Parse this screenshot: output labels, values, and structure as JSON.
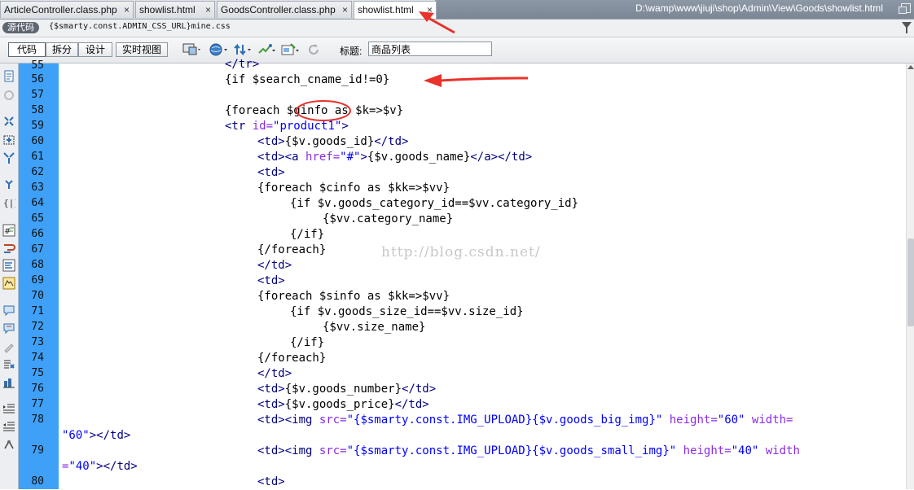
{
  "tabs": [
    {
      "label": "ArticleController.class.php",
      "active": false
    },
    {
      "label": "showlist.html",
      "active": false
    },
    {
      "label": "GoodsController.class.php",
      "active": false
    },
    {
      "label": "showlist.html",
      "active": true
    }
  ],
  "tab_close_glyph": "×",
  "file_path": "D:\\wamp\\www\\jiuji\\shop\\Admin\\View\\Goods\\showlist.html",
  "related_bar": {
    "source_label": "源代码",
    "related_file": "{$smarty.const.ADMIN_CSS_URL}mine.css"
  },
  "toolbar": {
    "views": [
      "代码",
      "拆分",
      "设计",
      "实时视图"
    ],
    "active_view": "代码",
    "title_label": "标题:",
    "title_value": "商品列表"
  },
  "icons": {
    "toolbar": [
      "multiscreen-icon",
      "preview-globe-icon",
      "file-transfer-icon",
      "debug-icon",
      "visual-aids-icon",
      "refresh-icon"
    ],
    "sidebar": [
      "open-documents-icon",
      "collapse-tag-icon",
      "collapse-selection-icon",
      "expand-all-icon",
      "select-parent-tag-icon",
      "balance-braces-icon",
      "line-numbers-icon",
      "highlight-invalid-icon",
      "word-wrap-icon",
      "syntax-coloring-icon",
      "apply-comment-icon",
      "remove-comment-icon",
      "wrap-tag-icon",
      "recent-snippets-icon",
      "move-css-icon",
      "indent-code-icon",
      "outdent-code-icon",
      "format-source-icon"
    ]
  },
  "colors": {
    "gutter": "#3fa0f7",
    "annotation": "#e8322b",
    "tag": "#000080",
    "attribute": "#8a2be2",
    "string": "#0000ff"
  },
  "code": {
    "line_numbers": [
      "55",
      "56",
      "57",
      "58",
      "59",
      "60",
      "61",
      "62",
      "63",
      "64",
      "65",
      "66",
      "67",
      "68",
      "69",
      "70",
      "71",
      "72",
      "73",
      "74",
      "75",
      "76",
      "77",
      "78",
      "",
      "79",
      "",
      "80"
    ],
    "lines": {
      "l55": "</tr>",
      "l56": "{if $search_cname_id!=0}",
      "l58a": "{foreach ",
      "l58b": "$ginfo",
      "l58c": " as $k=>$v}",
      "l59": [
        "<tr ",
        "id=",
        "\"product1\"",
        ">"
      ],
      "l60": [
        "<td>",
        "{$v.goods_id}",
        "</td>"
      ],
      "l61": [
        "<td>",
        "<a ",
        "href=",
        "\"#\"",
        ">",
        "{$v.goods_name}",
        "</a>",
        "</td>"
      ],
      "l62": "<td>",
      "l63": "{foreach $cinfo as $kk=>$vv}",
      "l64": "{if $v.goods_category_id==$vv.category_id}",
      "l65": "{$vv.category_name}",
      "l66": "{/if}",
      "l67": "{/foreach}",
      "l68": "</td>",
      "l69": "<td>",
      "l70": "{foreach $sinfo as $kk=>$vv}",
      "l71": "{if $v.goods_size_id==$vv.size_id}",
      "l72": "{$vv.size_name}",
      "l73": "{/if}",
      "l74": "{/foreach}",
      "l75": "</td>",
      "l76": [
        "<td>",
        "{$v.goods_number}",
        "</td>"
      ],
      "l77": [
        "<td>",
        "{$v.goods_price}",
        "</td>"
      ],
      "l78": [
        "<td>",
        "<img ",
        "src=",
        "\"{$smarty.const.IMG_UPLOAD}{$v.goods_big_img}\"",
        " height=",
        "\"60\"",
        " width="
      ],
      "l78w": [
        "\"60\"",
        ">",
        "</td>"
      ],
      "l79": [
        "<td>",
        "<img ",
        "src=",
        "\"{$smarty.const.IMG_UPLOAD}{$v.goods_small_img}\"",
        " height=",
        "\"40\"",
        " width"
      ],
      "l79w": [
        "=",
        "\"40\"",
        ">",
        "</td>"
      ],
      "l80": "<td>"
    }
  },
  "watermark": "http://blog.csdn.net/"
}
